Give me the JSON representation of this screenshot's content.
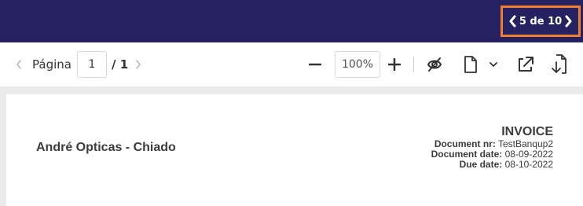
{
  "header": {
    "pager": {
      "text": "5 de 10",
      "prev_icon": "chevron-left-icon",
      "next_icon": "chevron-right-icon",
      "highlight_color": "#f07e2c"
    },
    "background": "#262262"
  },
  "toolbar": {
    "page_label": "Página",
    "page_value": "1",
    "page_total": "/ 1",
    "zoom_value": "100%",
    "icons": [
      "chevron-left-icon",
      "chevron-right-icon",
      "zoom-out-icon",
      "zoom-in-icon",
      "hide-annotations-icon",
      "document-icon",
      "chevron-down-icon",
      "open-external-icon",
      "download-document-icon"
    ]
  },
  "document": {
    "company": "André Opticas - Chiado",
    "title": "INVOICE",
    "rows": [
      {
        "label": "Document nr:",
        "value": "TestBanqup2"
      },
      {
        "label": "Document date:",
        "value": "08-09-2022"
      },
      {
        "label": "Due date:",
        "value": "08-10-2022"
      }
    ]
  }
}
